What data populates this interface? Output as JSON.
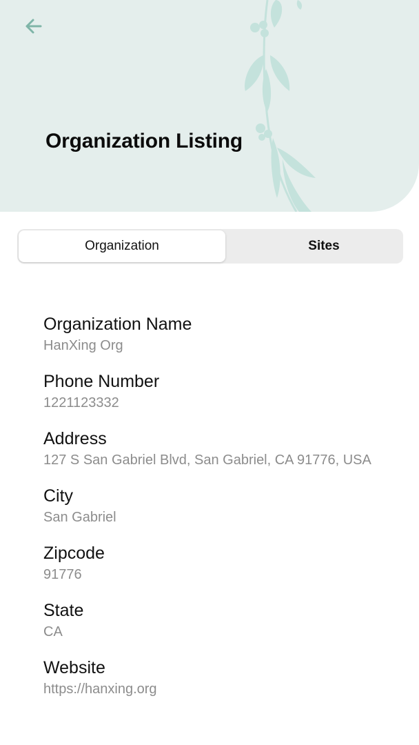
{
  "header": {
    "title": "Organization Listing",
    "background_color": "#e4eeec",
    "accent_color": "#7fb5a8",
    "back_icon": "arrow-left-icon",
    "decoration_icon": "leaf-branch-icon"
  },
  "tabs": {
    "selected": "Organization",
    "items": [
      {
        "label": "Organization",
        "active": true
      },
      {
        "label": "Sites",
        "active": false
      }
    ]
  },
  "fields": [
    {
      "label": "Organization Name",
      "value": "HanXing Org"
    },
    {
      "label": "Phone Number",
      "value": "1221123332"
    },
    {
      "label": "Address",
      "value": "127 S San Gabriel Blvd, San Gabriel, CA 91776, USA"
    },
    {
      "label": "City",
      "value": "San Gabriel"
    },
    {
      "label": "Zipcode",
      "value": "91776"
    },
    {
      "label": "State",
      "value": "CA"
    },
    {
      "label": "Website",
      "value": "https://hanxing.org"
    }
  ]
}
